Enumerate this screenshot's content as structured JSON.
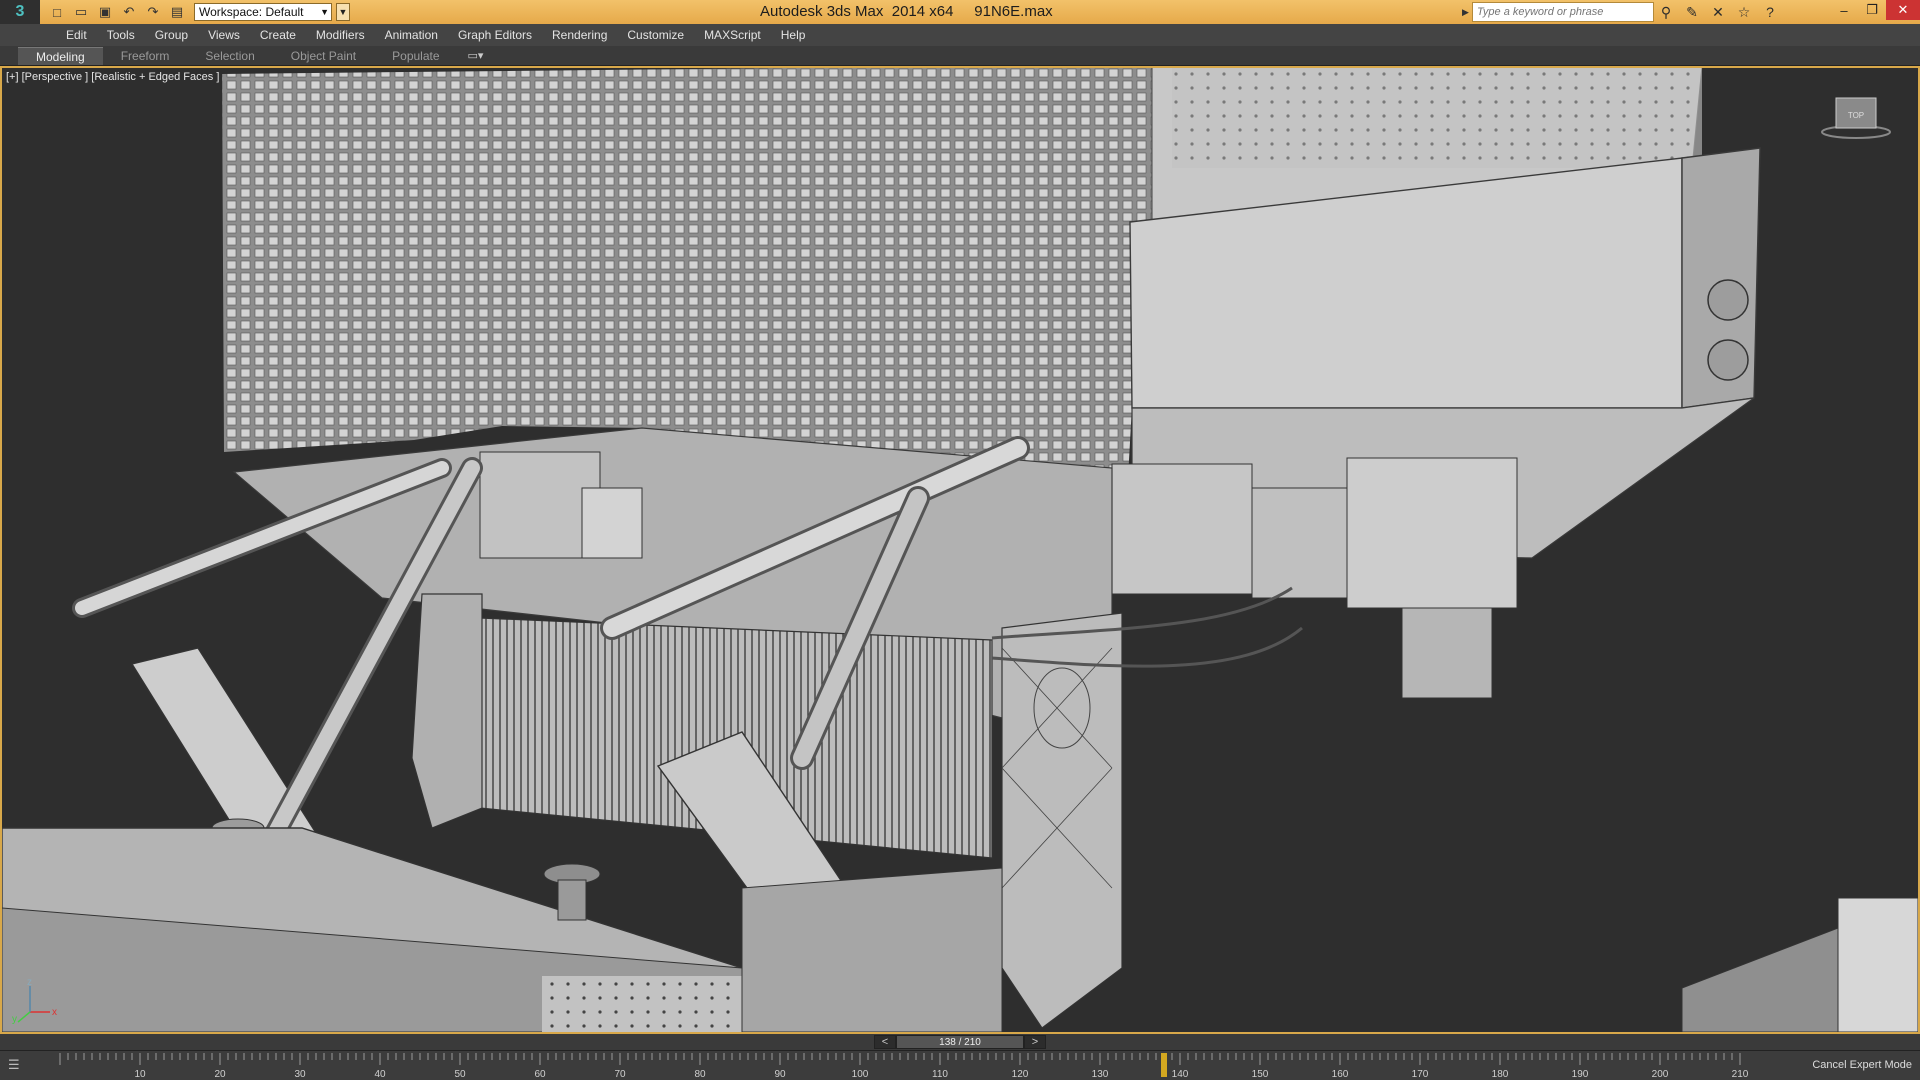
{
  "titlebar": {
    "logo_glyph": "3",
    "workspace_label": "Workspace: Default",
    "title": "Autodesk 3ds Max  2014 x64     91N6E.max",
    "search_placeholder": "Type a keyword or phrase",
    "quick_access": [
      {
        "icon": "new-file-icon",
        "glyph": "□"
      },
      {
        "icon": "open-file-icon",
        "glyph": "▭"
      },
      {
        "icon": "save-icon",
        "glyph": "▣"
      },
      {
        "icon": "undo-icon",
        "glyph": "↶"
      },
      {
        "icon": "redo-icon",
        "glyph": "↷"
      },
      {
        "icon": "project-folder-icon",
        "glyph": "▤"
      }
    ],
    "right_icons": [
      {
        "icon": "binoculars-icon",
        "glyph": "⚲"
      },
      {
        "icon": "subscription-icon",
        "glyph": "✎"
      },
      {
        "icon": "communication-icon",
        "glyph": "✕"
      },
      {
        "icon": "favorites-icon",
        "glyph": "☆"
      },
      {
        "icon": "help-icon",
        "glyph": "?"
      }
    ]
  },
  "menu": [
    "Edit",
    "Tools",
    "Group",
    "Views",
    "Create",
    "Modifiers",
    "Animation",
    "Graph Editors",
    "Rendering",
    "Customize",
    "MAXScript",
    "Help"
  ],
  "ribbon": {
    "tabs": [
      "Modeling",
      "Freeform",
      "Selection",
      "Object Paint",
      "Populate"
    ],
    "active": "Modeling"
  },
  "viewport": {
    "label": "[+] [Perspective ] [Realistic + Edged Faces ]",
    "border_color": "#d8a84a",
    "axis": {
      "x": "x",
      "y": "y",
      "z": "z"
    }
  },
  "timeslider": {
    "frame_text": "138 / 210",
    "prev": "<",
    "next": ">",
    "current": 138,
    "total": 210
  },
  "trackbar": {
    "ticks": [
      10,
      20,
      30,
      40,
      50,
      60,
      70,
      80,
      90,
      100,
      110,
      120,
      130,
      140,
      150,
      160,
      170,
      180,
      190,
      200,
      210
    ],
    "expert_label": "Cancel Expert Mode"
  },
  "colors": {
    "title_bar": "#e6a94a",
    "menu": "#444444",
    "viewport_bg": "#2e2e2e",
    "model_gray": "#b8b8b8",
    "playhead": "#d4a820"
  }
}
